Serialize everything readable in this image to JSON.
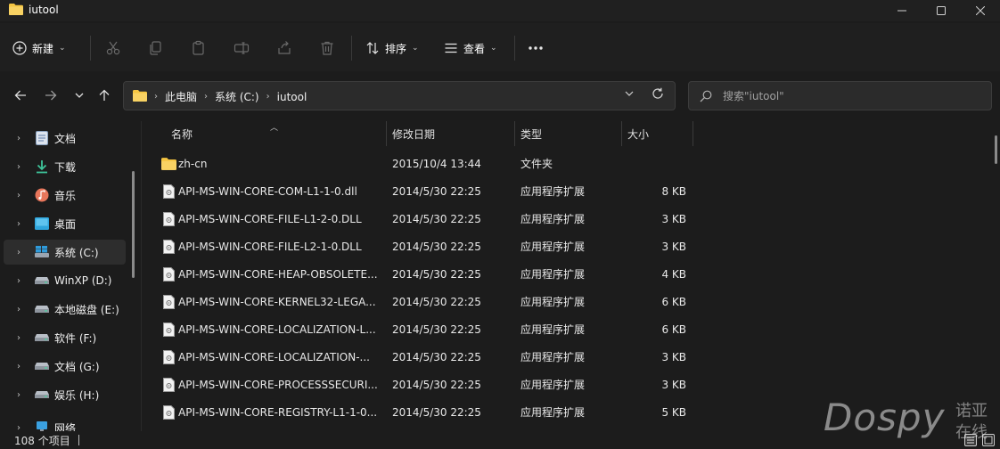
{
  "window": {
    "title": "iutool",
    "controls": [
      "minimize-icon",
      "maximize-icon",
      "close-icon"
    ]
  },
  "toolbar": {
    "new_label": "新建",
    "sort_label": "排序",
    "view_label": "查看",
    "icons": [
      "cut-icon",
      "copy-icon",
      "paste-icon",
      "rename-icon",
      "share-icon",
      "delete-icon",
      "more-icon"
    ]
  },
  "address": {
    "crumbs": [
      "此电脑",
      "系统 (C:)",
      "iutool"
    ]
  },
  "search": {
    "placeholder": "搜索\"iutool\""
  },
  "sidebar": {
    "items": [
      {
        "label": "文档",
        "icon": "documents-icon"
      },
      {
        "label": "下载",
        "icon": "download-icon"
      },
      {
        "label": "音乐",
        "icon": "music-icon"
      },
      {
        "label": "桌面",
        "icon": "desktop-icon"
      },
      {
        "label": "系统 (C:)",
        "icon": "system-drive-icon",
        "selected": true
      },
      {
        "label": "WinXP (D:)",
        "icon": "drive-icon"
      },
      {
        "label": "本地磁盘 (E:)",
        "icon": "drive-icon"
      },
      {
        "label": "软件 (F:)",
        "icon": "drive-icon"
      },
      {
        "label": "文档 (G:)",
        "icon": "drive-icon"
      },
      {
        "label": "娱乐 (H:)",
        "icon": "drive-icon"
      },
      {
        "label": "网络",
        "icon": "network-icon"
      }
    ]
  },
  "columns": {
    "name": "名称",
    "date": "修改日期",
    "type": "类型",
    "size": "大小"
  },
  "files": [
    {
      "name": "zh-cn",
      "date": "2015/10/4 13:44",
      "type": "文件夹",
      "size": "",
      "kind": "folder"
    },
    {
      "name": "API-MS-WIN-CORE-COM-L1-1-0.dll",
      "date": "2014/5/30 22:25",
      "type": "应用程序扩展",
      "size": "8 KB",
      "kind": "dll"
    },
    {
      "name": "API-MS-WIN-CORE-FILE-L1-2-0.DLL",
      "date": "2014/5/30 22:25",
      "type": "应用程序扩展",
      "size": "3 KB",
      "kind": "dll"
    },
    {
      "name": "API-MS-WIN-CORE-FILE-L2-1-0.DLL",
      "date": "2014/5/30 22:25",
      "type": "应用程序扩展",
      "size": "3 KB",
      "kind": "dll"
    },
    {
      "name": "API-MS-WIN-CORE-HEAP-OBSOLETE...",
      "date": "2014/5/30 22:25",
      "type": "应用程序扩展",
      "size": "4 KB",
      "kind": "dll"
    },
    {
      "name": "API-MS-WIN-CORE-KERNEL32-LEGA...",
      "date": "2014/5/30 22:25",
      "type": "应用程序扩展",
      "size": "6 KB",
      "kind": "dll"
    },
    {
      "name": "API-MS-WIN-CORE-LOCALIZATION-L...",
      "date": "2014/5/30 22:25",
      "type": "应用程序扩展",
      "size": "6 KB",
      "kind": "dll"
    },
    {
      "name": "API-MS-WIN-CORE-LOCALIZATION-...",
      "date": "2014/5/30 22:25",
      "type": "应用程序扩展",
      "size": "3 KB",
      "kind": "dll"
    },
    {
      "name": "API-MS-WIN-CORE-PROCESSSECURI...",
      "date": "2014/5/30 22:25",
      "type": "应用程序扩展",
      "size": "3 KB",
      "kind": "dll"
    },
    {
      "name": "API-MS-WIN-CORE-REGISTRY-L1-1-0...",
      "date": "2014/5/30 22:25",
      "type": "应用程序扩展",
      "size": "5 KB",
      "kind": "dll"
    }
  ],
  "status": {
    "count": "108 个项目"
  },
  "watermark": {
    "brand": "Dospy",
    "cn": "诺亚 在线"
  },
  "colors": {
    "window_bg": "#1c1c1c",
    "folder_yellow": "#f5c542",
    "accent": "#4cc2ff"
  }
}
